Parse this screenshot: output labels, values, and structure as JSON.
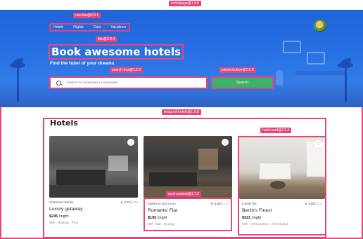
{
  "annotations": {
    "homepage": "homepage@1.9.0",
    "nav_bar": "nav-bar@2.0.1",
    "title": "title@3.0.4",
    "search_box": "search-box@1.2.0",
    "submit_button": "submit-button@2.0.0",
    "featured_hotels": "featured-hotels@1.0.8",
    "hotel_card": "hotel-card@2.0.3",
    "card_content": "card-content@1.7.2"
  },
  "nav": {
    "items": [
      "Hotels",
      "Flights",
      "Cars",
      "Vacations"
    ]
  },
  "hero": {
    "title": "Book awesome hotels",
    "subtitle": "Find the hotel of your dreams.",
    "search_placeholder": "Search for properties or keywords.",
    "search_button": "Search"
  },
  "featured": {
    "title": "Hotels",
    "cards": [
      {
        "type": "Charmant Studio",
        "rating": "4.71",
        "reviews": "(235)",
        "name": "Luxury getaway",
        "price": "$245",
        "per": "/night",
        "amenities": "Wifi · Heating · Pool"
      },
      {
        "type": "Sweet & cosy room",
        "rating": "4.63",
        "reviews": "(117)",
        "name": "Romantic Flat",
        "price": "$195",
        "per": "/night",
        "amenities": "Wifi · Bar · Heating"
      },
      {
        "type": "Lovely flat",
        "rating": "4.82",
        "reviews": "(421)",
        "name": "Berlin's Finest",
        "price": "$321",
        "per": "/night",
        "amenities": "Wifi · Hot Location · All Included"
      }
    ]
  },
  "colors": {
    "hero_blue": "#2b74e6",
    "annotation_pink": "#e8457a",
    "search_green": "#3ab367",
    "star_red": "#e3324b"
  }
}
